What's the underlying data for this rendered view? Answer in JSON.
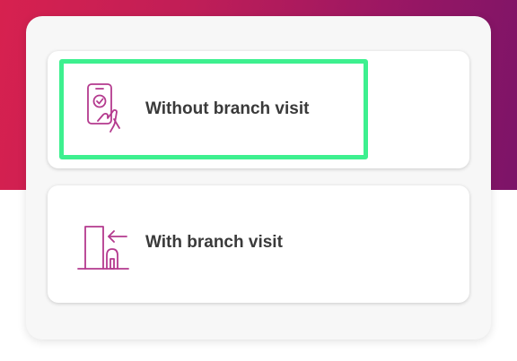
{
  "colors": {
    "hero_gradient_start": "#d7214f",
    "hero_gradient_end": "#7c1468",
    "icon_stroke": "#b43a8e",
    "highlight": "#3df08f",
    "label_text": "#3a3a3a"
  },
  "options": [
    {
      "label": "Without branch visit",
      "icon": "phone-checkmark-hand-icon",
      "selected": true
    },
    {
      "label": "With branch visit",
      "icon": "branch-door-arrow-icon",
      "selected": false
    }
  ]
}
